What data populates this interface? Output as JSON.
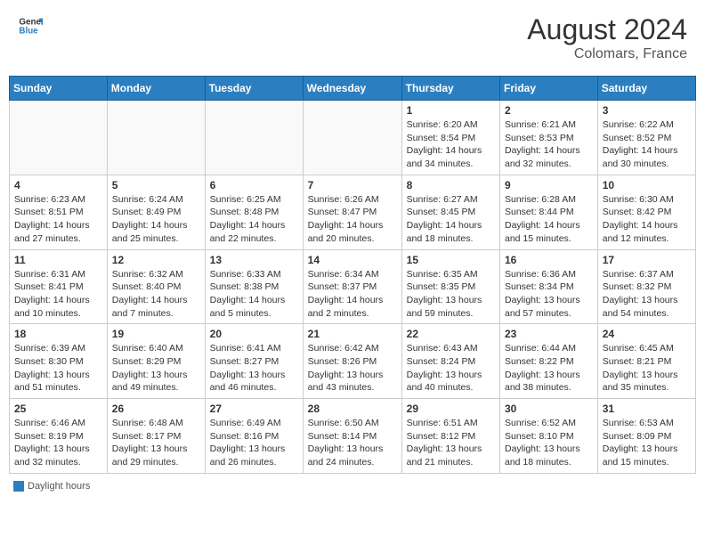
{
  "header": {
    "logo_line1": "General",
    "logo_line2": "Blue",
    "month": "August 2024",
    "location": "Colomars, France"
  },
  "weekdays": [
    "Sunday",
    "Monday",
    "Tuesday",
    "Wednesday",
    "Thursday",
    "Friday",
    "Saturday"
  ],
  "legend": {
    "label": "Daylight hours"
  },
  "weeks": [
    [
      {
        "day": "",
        "info": ""
      },
      {
        "day": "",
        "info": ""
      },
      {
        "day": "",
        "info": ""
      },
      {
        "day": "",
        "info": ""
      },
      {
        "day": "1",
        "info": "Sunrise: 6:20 AM\nSunset: 8:54 PM\nDaylight: 14 hours\nand 34 minutes."
      },
      {
        "day": "2",
        "info": "Sunrise: 6:21 AM\nSunset: 8:53 PM\nDaylight: 14 hours\nand 32 minutes."
      },
      {
        "day": "3",
        "info": "Sunrise: 6:22 AM\nSunset: 8:52 PM\nDaylight: 14 hours\nand 30 minutes."
      }
    ],
    [
      {
        "day": "4",
        "info": "Sunrise: 6:23 AM\nSunset: 8:51 PM\nDaylight: 14 hours\nand 27 minutes."
      },
      {
        "day": "5",
        "info": "Sunrise: 6:24 AM\nSunset: 8:49 PM\nDaylight: 14 hours\nand 25 minutes."
      },
      {
        "day": "6",
        "info": "Sunrise: 6:25 AM\nSunset: 8:48 PM\nDaylight: 14 hours\nand 22 minutes."
      },
      {
        "day": "7",
        "info": "Sunrise: 6:26 AM\nSunset: 8:47 PM\nDaylight: 14 hours\nand 20 minutes."
      },
      {
        "day": "8",
        "info": "Sunrise: 6:27 AM\nSunset: 8:45 PM\nDaylight: 14 hours\nand 18 minutes."
      },
      {
        "day": "9",
        "info": "Sunrise: 6:28 AM\nSunset: 8:44 PM\nDaylight: 14 hours\nand 15 minutes."
      },
      {
        "day": "10",
        "info": "Sunrise: 6:30 AM\nSunset: 8:42 PM\nDaylight: 14 hours\nand 12 minutes."
      }
    ],
    [
      {
        "day": "11",
        "info": "Sunrise: 6:31 AM\nSunset: 8:41 PM\nDaylight: 14 hours\nand 10 minutes."
      },
      {
        "day": "12",
        "info": "Sunrise: 6:32 AM\nSunset: 8:40 PM\nDaylight: 14 hours\nand 7 minutes."
      },
      {
        "day": "13",
        "info": "Sunrise: 6:33 AM\nSunset: 8:38 PM\nDaylight: 14 hours\nand 5 minutes."
      },
      {
        "day": "14",
        "info": "Sunrise: 6:34 AM\nSunset: 8:37 PM\nDaylight: 14 hours\nand 2 minutes."
      },
      {
        "day": "15",
        "info": "Sunrise: 6:35 AM\nSunset: 8:35 PM\nDaylight: 13 hours\nand 59 minutes."
      },
      {
        "day": "16",
        "info": "Sunrise: 6:36 AM\nSunset: 8:34 PM\nDaylight: 13 hours\nand 57 minutes."
      },
      {
        "day": "17",
        "info": "Sunrise: 6:37 AM\nSunset: 8:32 PM\nDaylight: 13 hours\nand 54 minutes."
      }
    ],
    [
      {
        "day": "18",
        "info": "Sunrise: 6:39 AM\nSunset: 8:30 PM\nDaylight: 13 hours\nand 51 minutes."
      },
      {
        "day": "19",
        "info": "Sunrise: 6:40 AM\nSunset: 8:29 PM\nDaylight: 13 hours\nand 49 minutes."
      },
      {
        "day": "20",
        "info": "Sunrise: 6:41 AM\nSunset: 8:27 PM\nDaylight: 13 hours\nand 46 minutes."
      },
      {
        "day": "21",
        "info": "Sunrise: 6:42 AM\nSunset: 8:26 PM\nDaylight: 13 hours\nand 43 minutes."
      },
      {
        "day": "22",
        "info": "Sunrise: 6:43 AM\nSunset: 8:24 PM\nDaylight: 13 hours\nand 40 minutes."
      },
      {
        "day": "23",
        "info": "Sunrise: 6:44 AM\nSunset: 8:22 PM\nDaylight: 13 hours\nand 38 minutes."
      },
      {
        "day": "24",
        "info": "Sunrise: 6:45 AM\nSunset: 8:21 PM\nDaylight: 13 hours\nand 35 minutes."
      }
    ],
    [
      {
        "day": "25",
        "info": "Sunrise: 6:46 AM\nSunset: 8:19 PM\nDaylight: 13 hours\nand 32 minutes."
      },
      {
        "day": "26",
        "info": "Sunrise: 6:48 AM\nSunset: 8:17 PM\nDaylight: 13 hours\nand 29 minutes."
      },
      {
        "day": "27",
        "info": "Sunrise: 6:49 AM\nSunset: 8:16 PM\nDaylight: 13 hours\nand 26 minutes."
      },
      {
        "day": "28",
        "info": "Sunrise: 6:50 AM\nSunset: 8:14 PM\nDaylight: 13 hours\nand 24 minutes."
      },
      {
        "day": "29",
        "info": "Sunrise: 6:51 AM\nSunset: 8:12 PM\nDaylight: 13 hours\nand 21 minutes."
      },
      {
        "day": "30",
        "info": "Sunrise: 6:52 AM\nSunset: 8:10 PM\nDaylight: 13 hours\nand 18 minutes."
      },
      {
        "day": "31",
        "info": "Sunrise: 6:53 AM\nSunset: 8:09 PM\nDaylight: 13 hours\nand 15 minutes."
      }
    ]
  ]
}
